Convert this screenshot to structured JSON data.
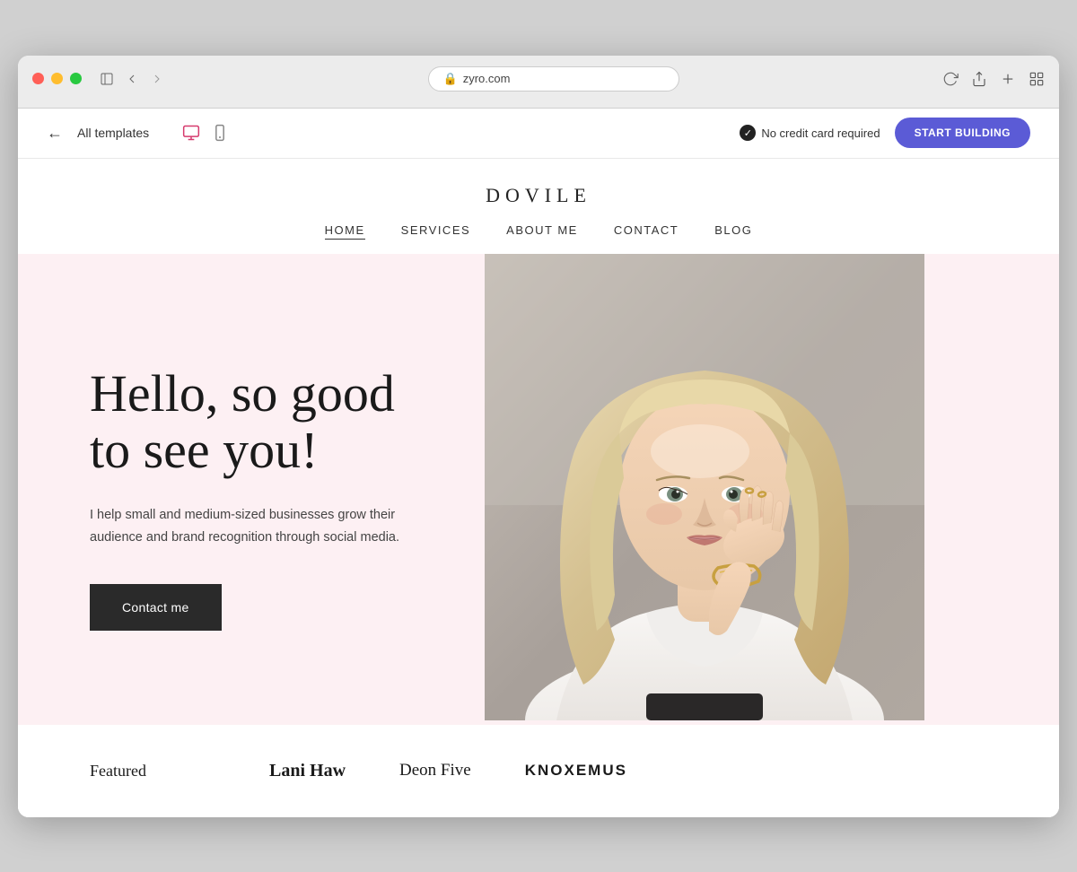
{
  "browser": {
    "url": "zyro.com",
    "dots": [
      "red",
      "yellow",
      "green"
    ]
  },
  "appbar": {
    "back_label": "←",
    "all_templates": "All templates",
    "no_credit_label": "No credit card required",
    "start_building": "START BUILDING"
  },
  "site": {
    "logo": "DOVILE",
    "nav": [
      {
        "label": "HOME",
        "active": true
      },
      {
        "label": "SERVICES",
        "active": false
      },
      {
        "label": "ABOUT ME",
        "active": false
      },
      {
        "label": "CONTACT",
        "active": false
      },
      {
        "label": "BLOG",
        "active": false
      }
    ],
    "hero": {
      "title": "Hello, so good to see you!",
      "subtitle": "I help small and medium-sized businesses grow their audience and brand recognition through social media.",
      "cta": "Contact me"
    },
    "featured": {
      "label": "Featured",
      "brands": [
        {
          "name": "Lani Haw",
          "style": "bold"
        },
        {
          "name": "Deon Five",
          "style": "light"
        },
        {
          "name": "KNOXEMUS",
          "style": "caps"
        }
      ]
    }
  }
}
